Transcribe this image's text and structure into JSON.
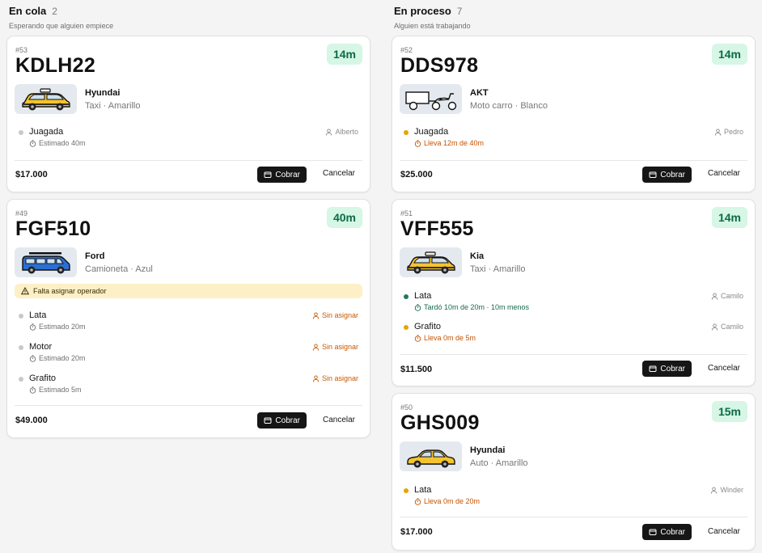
{
  "queue": {
    "title": "En cola",
    "count": "2",
    "subtitle": "Esperando que alguien empiece",
    "cards": [
      {
        "num": "#53",
        "plate": "KDLH22",
        "timer": "14m",
        "brand": "Hyundai",
        "desc": "Taxi · Amarillo",
        "services": [
          {
            "name": "Juagada",
            "time": "Estimado 40m",
            "operator": "Alberto"
          }
        ],
        "total": "$17.000"
      },
      {
        "num": "#49",
        "plate": "FGF510",
        "timer": "40m",
        "brand": "Ford",
        "desc": "Camioneta · Azul",
        "warning": "Falta asignar operador",
        "services": [
          {
            "name": "Lata",
            "time": "Estimado 20m",
            "operator": "Sin asignar"
          },
          {
            "name": "Motor",
            "time": "Estimado 20m",
            "operator": "Sin asignar"
          },
          {
            "name": "Grafito",
            "time": "Estimado 5m",
            "operator": "Sin asignar"
          }
        ],
        "total": "$49.000"
      }
    ]
  },
  "progress": {
    "title": "En proceso",
    "count": "7",
    "subtitle": "Alguien está trabajando",
    "cards": [
      {
        "num": "#52",
        "plate": "DDS978",
        "timer": "14m",
        "brand": "AKT",
        "desc": "Moto carro · Blanco",
        "services": [
          {
            "name": "Juagada",
            "time": "Lleva 12m de 40m",
            "operator": "Pedro"
          }
        ],
        "total": "$25.000"
      },
      {
        "num": "#51",
        "plate": "VFF555",
        "timer": "14m",
        "brand": "Kia",
        "desc": "Taxi · Amarillo",
        "services": [
          {
            "name": "Lata",
            "time": "Tardó 10m de 20m · 10m menos",
            "operator": "Camilo"
          },
          {
            "name": "Grafito",
            "time": "Lleva 0m de 5m",
            "operator": "Camilo"
          }
        ],
        "total": "$11.500"
      },
      {
        "num": "#50",
        "plate": "GHS009",
        "timer": "15m",
        "brand": "Hyundai",
        "desc": "Auto · Amarillo",
        "services": [
          {
            "name": "Lata",
            "time": "Lleva 0m de 20m",
            "operator": "Winder"
          }
        ],
        "total": "$17.000"
      }
    ]
  },
  "actions": {
    "charge": "Cobrar",
    "cancel": "Cancelar"
  },
  "icons": {
    "timer": "stopwatch-icon",
    "operator": "person-icon",
    "warning": "warning-triangle-icon",
    "charge": "wallet-icon",
    "vehicles": [
      "taxi-icon",
      "pickup-truck-icon",
      "motocarro-icon",
      "taxi-icon",
      "car-icon"
    ]
  },
  "colors": {
    "timer_bg": "#d6f6e6",
    "timer_text": "#0d6b44",
    "warning_bg": "#fdf0c7",
    "unassigned": "#c75a00",
    "in_progress": "#e6a500",
    "done": "#1f7a5a",
    "pending": "#c8c8c8"
  }
}
